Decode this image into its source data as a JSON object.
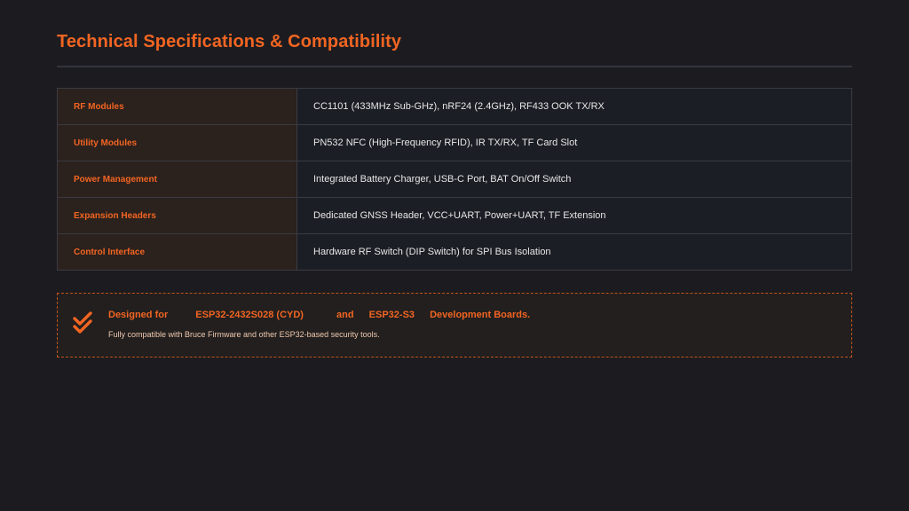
{
  "page": {
    "title": "Technical Specifications & Compatibility"
  },
  "specs": [
    {
      "label": "RF Modules",
      "value": "CC1101 (433MHz Sub-GHz), nRF24 (2.4GHz), RF433 OOK TX/RX"
    },
    {
      "label": "Utility Modules",
      "value": "PN532 NFC (High-Frequency RFID), IR TX/RX, TF Card Slot"
    },
    {
      "label": "Power Management",
      "value": "Integrated Battery Charger, USB-C Port, BAT On/Off Switch"
    },
    {
      "label": "Expansion Headers",
      "value": "Dedicated GNSS Header, VCC+UART, Power+UART, TF Extension"
    },
    {
      "label": "Control Interface",
      "value": "Hardware RF Switch (DIP Switch) for SPI Bus Isolation"
    }
  ],
  "compatibility": {
    "icon": "double-check-icon",
    "headline_prefix": "Designed for",
    "board_1": "ESP32-2432S028 (CYD)",
    "conjunction": "and",
    "board_2": "ESP32-S3",
    "headline_suffix": "Development Boards.",
    "subtext": "Fully compatible with Bruce Firmware and other ESP32-based security tools."
  },
  "colors": {
    "accent": "#f26522",
    "background": "#1c1c20",
    "label_cell": "#2b211d",
    "value_cell": "#1c1e25"
  }
}
